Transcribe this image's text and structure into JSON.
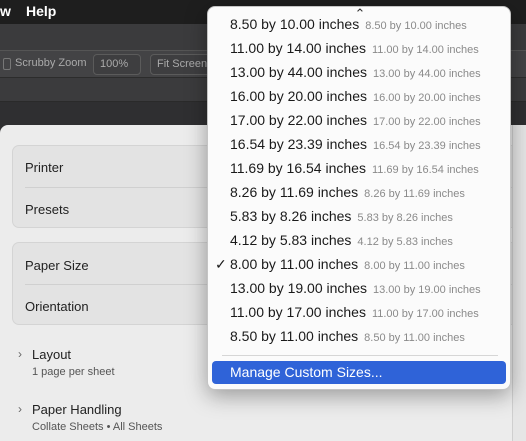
{
  "menubar": {
    "items": [
      "w",
      "Help"
    ]
  },
  "toolbar": {
    "scrubby_zoom_label": "Scrubby Zoom",
    "zoom_value": "100%",
    "fit_screen_label": "Fit Screen"
  },
  "dialog": {
    "printer_label": "Printer",
    "presets_label": "Presets",
    "paper_size_label": "Paper Size",
    "orientation_label": "Orientation",
    "layout": {
      "title": "Layout",
      "subtitle": "1 page per sheet"
    },
    "paper_handling": {
      "title": "Paper Handling",
      "subtitle": "Collate Sheets • All Sheets"
    }
  },
  "paper_menu": {
    "scroll_up_glyph": "⌃",
    "checkmark": "✓",
    "selected_index": 10,
    "items": [
      {
        "label": "8.50 by 10.00 inches",
        "sub": "8.50 by 10.00 inches"
      },
      {
        "label": "11.00 by 14.00 inches",
        "sub": "11.00 by 14.00 inches"
      },
      {
        "label": "13.00 by 44.00 inches",
        "sub": "13.00 by 44.00 inches"
      },
      {
        "label": "16.00 by 20.00 inches",
        "sub": "16.00 by 20.00 inches"
      },
      {
        "label": "17.00 by 22.00 inches",
        "sub": "17.00 by 22.00 inches"
      },
      {
        "label": "16.54 by 23.39 inches",
        "sub": "16.54 by 23.39 inches"
      },
      {
        "label": "11.69 by 16.54 inches",
        "sub": "11.69 by 16.54 inches"
      },
      {
        "label": "8.26 by 11.69 inches",
        "sub": "8.26 by 11.69 inches"
      },
      {
        "label": "5.83 by 8.26 inches",
        "sub": "5.83 by 8.26 inches"
      },
      {
        "label": "4.12 by 5.83 inches",
        "sub": "4.12 by 5.83 inches"
      },
      {
        "label": "8.00 by 11.00 inches",
        "sub": "8.00 by 11.00 inches"
      },
      {
        "label": "13.00 by 19.00 inches",
        "sub": "13.00 by 19.00 inches"
      },
      {
        "label": "11.00 by 17.00 inches",
        "sub": "11.00 by 17.00 inches"
      },
      {
        "label": "8.50 by 11.00 inches",
        "sub": "8.50 by 11.00 inches"
      }
    ],
    "action_label": "Manage Custom Sizes..."
  },
  "colors": {
    "accent": "#2f63d8",
    "menu_bg": "#fbfbfb",
    "sheet_bg": "#ececec"
  }
}
